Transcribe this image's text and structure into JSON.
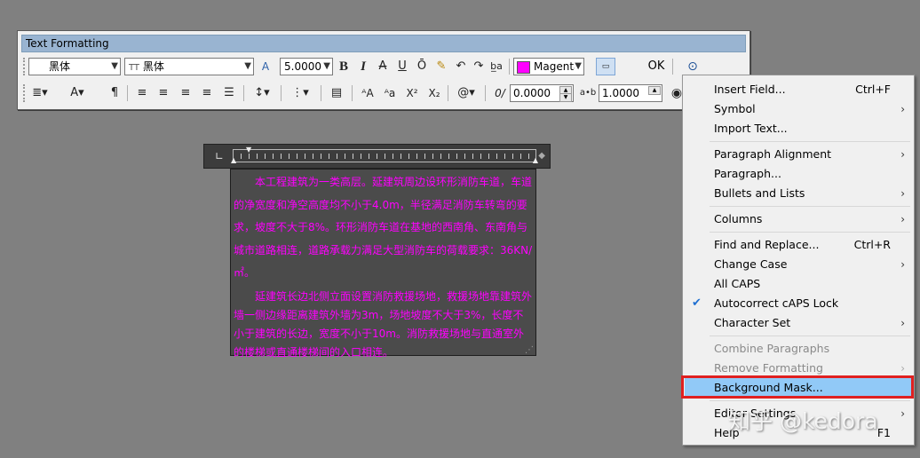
{
  "toolbar": {
    "title": "Text Formatting",
    "style_value": "黑体",
    "font_value": "黑体",
    "font_prefix": "TT",
    "height_value": "5.0000",
    "color_value": "Magenta",
    "color_hex": "#ff00ff",
    "ok_label": "OK",
    "oblique_value": "0.0000",
    "width_factor_value": "1.0000",
    "icons": {
      "bold": "B",
      "italic": "I",
      "strike": "A",
      "underline": "U",
      "overline": "Ō",
      "x2sup": "X²",
      "x2sub": "X₂",
      "at": "@",
      "oblique": "0/",
      "ab": "a•b",
      "annotative": "A"
    }
  },
  "editor": {
    "para1": "本工程建筑为一类高层。延建筑周边设环形消防车道，车道的净宽度和净空高度均不小于4.0m，半径满足消防车转弯的要求，坡度不大于8%。环形消防车道在基地的西南角、东南角与城市道路相连，道路承载力满足大型消防车的荷载要求：36KN/㎡。",
    "para2": "延建筑长边北侧立面设置消防救援场地，救援场地靠建筑外墙一侧边缘距离建筑外墙为3m，场地坡度不大于3%，长度不小于建筑的长边，宽度不小于10m。消防救援场地与直通室外的楼梯或直通楼梯间的入口相连。",
    "text_color": "#ff00ff"
  },
  "menu": {
    "items": [
      {
        "label": "Insert Field...",
        "shortcut": "Ctrl+F",
        "submenu": false
      },
      {
        "label": "Symbol",
        "shortcut": "",
        "submenu": true
      },
      {
        "label": "Import Text...",
        "shortcut": "",
        "submenu": false
      },
      {
        "label": "Paragraph Alignment",
        "shortcut": "",
        "submenu": true
      },
      {
        "label": "Paragraph...",
        "shortcut": "",
        "submenu": false
      },
      {
        "label": "Bullets and Lists",
        "shortcut": "",
        "submenu": true
      },
      {
        "label": "Columns",
        "shortcut": "",
        "submenu": true
      },
      {
        "label": "Find and Replace...",
        "shortcut": "Ctrl+R",
        "submenu": false
      },
      {
        "label": "Change Case",
        "shortcut": "",
        "submenu": true
      },
      {
        "label": "All CAPS",
        "shortcut": "",
        "submenu": false
      },
      {
        "label": "Autocorrect cAPS Lock",
        "shortcut": "",
        "submenu": false,
        "checked": true
      },
      {
        "label": "Character Set",
        "shortcut": "",
        "submenu": true
      },
      {
        "label": "Combine Paragraphs",
        "shortcut": "",
        "submenu": false,
        "disabled": true
      },
      {
        "label": "Remove Formatting",
        "shortcut": "",
        "submenu": true,
        "disabled": true
      },
      {
        "label": "Background Mask...",
        "shortcut": "",
        "submenu": false,
        "highlighted": true
      },
      {
        "label": "Editor Settings",
        "shortcut": "",
        "submenu": true
      },
      {
        "label": "Help",
        "shortcut": "F1",
        "submenu": false
      }
    ]
  },
  "watermark": "知乎 @kedora",
  "colors": {
    "highlight_box": "#e02020",
    "menu_highlight": "#91c9f7",
    "title_bar": "#99b4d1"
  }
}
